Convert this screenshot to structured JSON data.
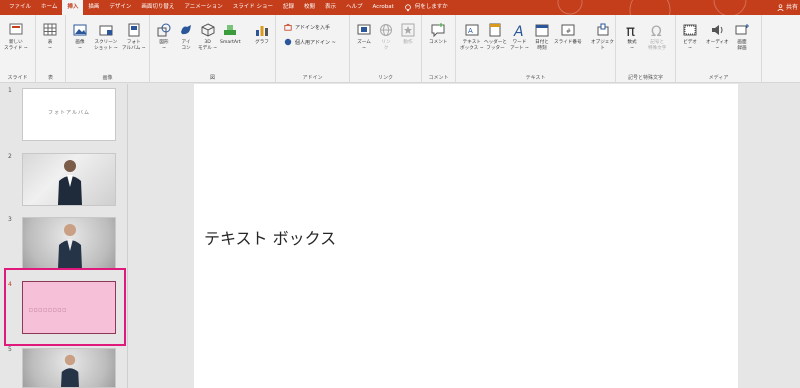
{
  "ribbon_tabs": [
    "ファイル",
    "ホーム",
    "挿入",
    "描画",
    "デザイン",
    "画面切り替え",
    "アニメーション",
    "スライド ショー",
    "記録",
    "校閲",
    "表示",
    "ヘルプ",
    "Acrobat"
  ],
  "active_tab": "挿入",
  "tell_me": "何をしますか",
  "share": "共有",
  "groups": {
    "slides": {
      "label": "スライド",
      "new_slide": "新しい\nスライド ~"
    },
    "table": {
      "label": "表",
      "table": "表\n~"
    },
    "images": {
      "label": "画像",
      "picture": "画像\n~",
      "screenshot": "スクリーン\nショット ~",
      "album": "フォト\nアルバム ~"
    },
    "illustrations": {
      "label": "図",
      "shapes": "図形\n~",
      "icons": "アイ\nコン",
      "models": "3D\nモデル ~",
      "smartart": "SmartArt",
      "chart": "グラフ"
    },
    "designer": {
      "label": "アドイン",
      "get_addins": "アドインを入手",
      "my_addins": "個人用アドイン  ~"
    },
    "links": {
      "label": "リンク",
      "zoom": "ズーム\n~",
      "link": "リン\nク",
      "action": "動作"
    },
    "comments": {
      "label": "コメント",
      "comment": "コメント"
    },
    "text": {
      "label": "テキスト",
      "textbox": "テキスト\nボックス ~",
      "header": "ヘッダーと\nフッター",
      "wordart": "ワード\nアート ~",
      "datetime": "日付と\n時刻",
      "slidenum": "スライド番号",
      "object": "オブジェクト"
    },
    "symbols": {
      "label": "記号と特殊文字",
      "equation": "数式\n~",
      "symbol": "記号と\n特殊文字"
    },
    "media": {
      "label": "メディア",
      "video": "ビデオ\n~",
      "audio": "オーディオ\n~",
      "record": "画面\n録画"
    }
  },
  "slides": [
    {
      "num": "1",
      "text": "フォトアルバム"
    },
    {
      "num": "2",
      "text": ""
    },
    {
      "num": "3",
      "text": ""
    },
    {
      "num": "4",
      "text": "□□□□□□□□"
    },
    {
      "num": "5",
      "text": ""
    }
  ],
  "current_slide_text": "テキスト ボックス",
  "colors": {
    "accent": "#c43e1c",
    "selection": "#e0197d",
    "selected_slide_bg": "#f6c0d8"
  }
}
